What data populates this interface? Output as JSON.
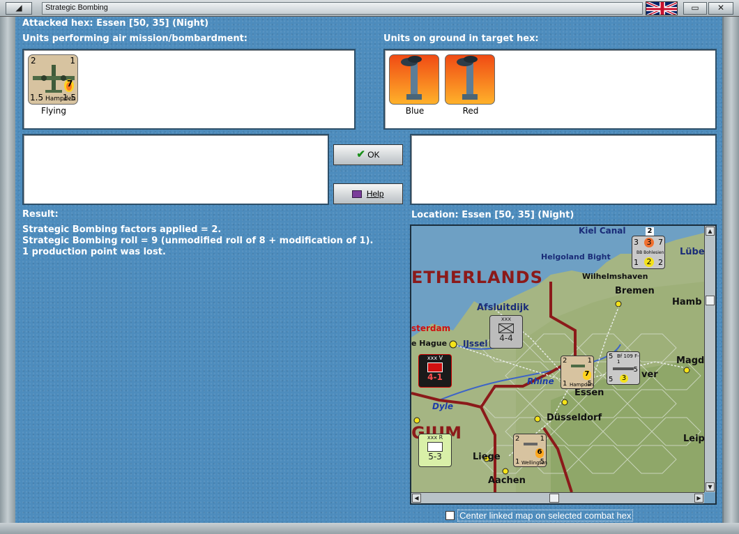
{
  "window": {
    "title": "Strategic Bombing",
    "minimize_glyph": "◢",
    "close_glyph": "✕",
    "restore_glyph": "▭"
  },
  "header": {
    "attacked_hex": "Attacked hex: Essen  [50, 35] (Night)"
  },
  "attackers": {
    "label": "Units performing air mission/bombardment:",
    "units": [
      {
        "name": "Hampden",
        "status": "Flying",
        "top_left": "2",
        "top_right": "1",
        "bottom_left": "1.5",
        "bottom_right": "1.5",
        "factor": "7"
      }
    ]
  },
  "defenders": {
    "label": "Units on ground in target hex:",
    "units": [
      {
        "status": "Blue"
      },
      {
        "status": "Red"
      }
    ]
  },
  "buttons": {
    "ok_label": "OK",
    "help_label": "Help"
  },
  "result": {
    "label": "Result:",
    "lines": [
      "Strategic Bombing factors applied = 2.",
      "Strategic Bombing roll = 9 (unmodified roll of 8 + modification of 1).",
      "1 production point was lost."
    ]
  },
  "location": {
    "label": "Location:  Essen  [50, 35] (Night)"
  },
  "map": {
    "places": {
      "kiel": "Kiel Canal",
      "lubeck": "Lübe",
      "helgoland": "Helgoland Bight",
      "wilhelmshaven": "Wilhelmshaven",
      "netherlands": "ETHERLANDS",
      "bremen": "Bremen",
      "hamburg": "Hamb",
      "afsluitdijk": "Afsluitdijk",
      "amsterdam": "sterdam",
      "hague": "e Hague",
      "ijssel": "IJssel",
      "rhine": "Rhine",
      "essen": "Essen",
      "dyle": "Dyle",
      "dusseldorf": "Düsseldorf",
      "belgium": "GIUM",
      "liege": "Liege",
      "aachen": "Aachen",
      "magd": "Magd",
      "leip": "Leip",
      "hanover": "ver"
    },
    "counters": {
      "bohlesien": {
        "type": "BB Bohlesien",
        "top": "3",
        "a": "3",
        "b": "7",
        "c": "1",
        "d": "2",
        "e": "2",
        "stack": "2"
      },
      "corps_nl": {
        "size": "xxx",
        "value": "4-4"
      },
      "corps_red": {
        "size": "xxx",
        "value": "4-1",
        "tag": "V"
      },
      "hampden_map": {
        "name": "Hampden",
        "tl": "2",
        "tr": "1",
        "bl": "1",
        "br": "5",
        "f": "7"
      },
      "bf109": {
        "name": "Bf 109 F-1",
        "tl": "5",
        "tr": "5",
        "bl": "5",
        "f": "3"
      },
      "corps_fr": {
        "size": "xxx",
        "value": "5-3",
        "tag": "R"
      },
      "wellington": {
        "name": "Wellington",
        "tl": "2",
        "tr": "1",
        "bl": "1",
        "br": "5",
        "f": "6"
      }
    }
  },
  "options": {
    "center_map_label": "Center linked map on selected combat hex",
    "center_map_checked": false
  },
  "colors": {
    "client_bg": "#4d8cbd",
    "panel_border": "#2d4f69",
    "frontier": "#8b1a1a",
    "land": "#a5b583",
    "sea": "#6ea0c4"
  }
}
